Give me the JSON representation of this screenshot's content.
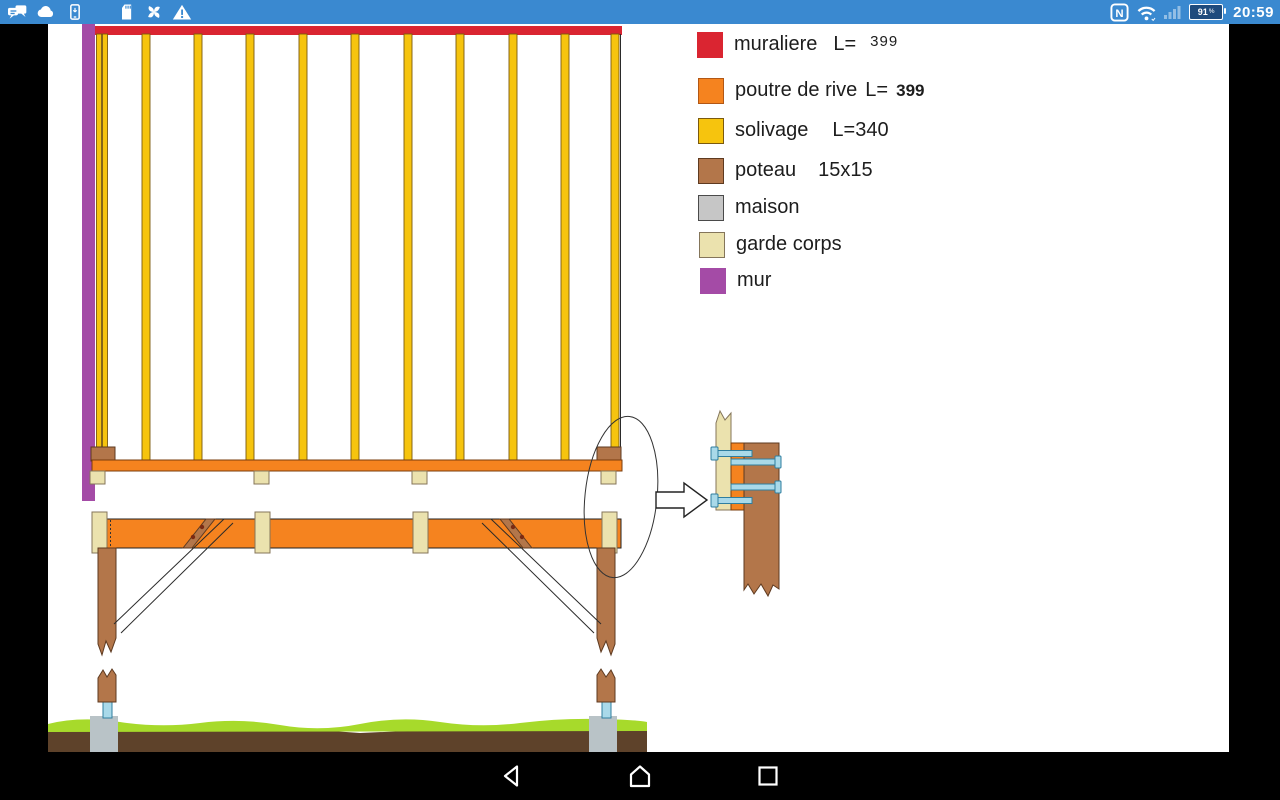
{
  "status_bar": {
    "time": "20:59",
    "nfc_letter": "N",
    "battery": {
      "percent": "91",
      "symbol": "%"
    },
    "left_icons": [
      "chat",
      "cloud",
      "phone",
      "sd-card",
      "fan",
      "warning"
    ],
    "right_icons": [
      "nfc",
      "wifi",
      "signal",
      "battery"
    ]
  },
  "legend": {
    "items": [
      {
        "label": "muraliere",
        "dim": "L=",
        "value": "399"
      },
      {
        "label": "poutre de rive",
        "dim": "L=",
        "value": "399"
      },
      {
        "label": "solivage",
        "dim": "L=340",
        "value": ""
      },
      {
        "label": "poteau",
        "dim": "15x15",
        "value": ""
      },
      {
        "label": "maison",
        "dim": "",
        "value": ""
      },
      {
        "label": "garde corps",
        "dim": "",
        "value": ""
      },
      {
        "label": "mur",
        "dim": "",
        "value": ""
      }
    ]
  },
  "nav_bar": {
    "icons": [
      "back",
      "home",
      "recents"
    ]
  },
  "colors": {
    "muraliere": "#da2531",
    "poutre_de_rive": "#f5831f",
    "solivage": "#f6c40e",
    "poteau": "#b3764a",
    "maison": "#c6c6c6",
    "garde_corps": "#ebe2ae",
    "mur": "#a44ba6",
    "bolt": "#a9d9e9",
    "bolt_outline": "#2f7e9f",
    "concrete": "#b9c3c7",
    "earth": "#5e422a",
    "grass": "#a7da2b",
    "status_bar": "#3a89d0",
    "chrome": "#000000",
    "canvas": "#ffffff",
    "ink": "#1d1d1d"
  }
}
